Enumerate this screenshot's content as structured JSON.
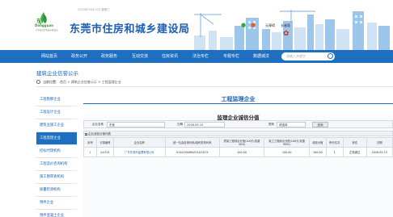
{
  "header": {
    "date_text": "2024年05月15日 星期三",
    "logo_cn": "东莞",
    "logo_en": "Dongguan",
    "logo_sub": "东莞市住房和城乡建设局",
    "site_title": "东莞市住房和城乡建设局",
    "util_links": [
      "无障碍",
      "长者版"
    ]
  },
  "nav": {
    "items": [
      "网站首页",
      "政务公开",
      "政务服务",
      "互动交流",
      "住房资讯",
      "法治专栏",
      "专题专栏",
      "数据城汶"
    ],
    "search_placeholder": "请输入关键字"
  },
  "section_title": "建筑企业信誉公示",
  "breadcrumb": {
    "label": "当前位置:",
    "path": "首页 > 建筑企业信誉公示 > 工程监理企业"
  },
  "sidebar": {
    "items": [
      "工程勘察企业",
      "工程设计企业",
      "建筑业施工企业",
      "工程监理企业",
      "招标代理机构",
      "工程造价咨询机构",
      "施工图审查机构",
      "质量检测机构",
      "预拌企业",
      "预拌混凝土企业"
    ],
    "active_index": 3
  },
  "main": {
    "title": "工程监理企业",
    "panel_title": "监理企业诚信分值",
    "filter": {
      "name_label": "企业名称",
      "name_value": "东莞",
      "date_label": "日期",
      "date_value": "2026-05-15",
      "category_label": "类别",
      "category_value": "请选择",
      "button": "查询"
    },
    "list_header": "企业诚信分值列表",
    "columns": [
      "序号",
      "记录编号",
      "企业名称",
      "统一社会信用代码/组织机构代码",
      "质量工程综合分值(100分,权重40%)",
      "竣工工程综合分值(100分,权重60%)",
      "诚信分值",
      "积分名次",
      "状态",
      "日期"
    ],
    "rows": [
      {
        "index": "1",
        "record_no": "JL0701",
        "company": "广东东莞市监理有限公司",
        "credit_code": "91441900MA51LD2D7X",
        "quality_score": "100.00",
        "completion_score": "100.00",
        "credit_score": "100.00",
        "rank": "1",
        "status": "正常通过",
        "date": "2026-05-15"
      }
    ]
  },
  "colors": {
    "primary": "#1e6fc0",
    "title_blue": "#1e5fb3",
    "logo_green": "#3a9a3a"
  }
}
